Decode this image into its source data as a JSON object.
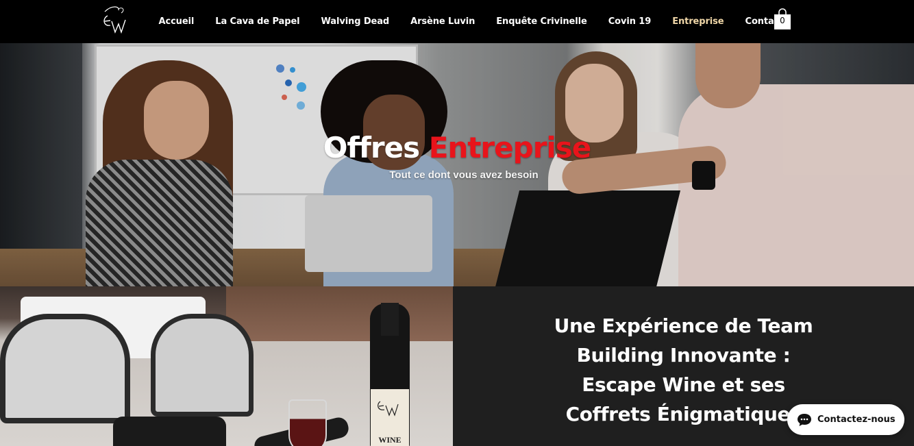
{
  "header": {
    "logo_text": "EW",
    "nav": [
      {
        "label": "Accueil",
        "active": false
      },
      {
        "label": "La Cava de Papel",
        "active": false
      },
      {
        "label": "Walving Dead",
        "active": false
      },
      {
        "label": "Arsène Luvin",
        "active": false
      },
      {
        "label": "Enquête Crivinelle",
        "active": false
      },
      {
        "label": "Covin 19",
        "active": false
      },
      {
        "label": "Entreprise",
        "active": true
      },
      {
        "label": "Contact",
        "active": false
      }
    ],
    "cart_count": "0",
    "active_color": "#f0d7a8"
  },
  "hero": {
    "title_white": "Offres",
    "title_red": "Entreprise",
    "subtitle": "Tout ce dont vous avez besoin",
    "title_red_color": "#e8141b"
  },
  "feature": {
    "title_lines": [
      "Une Expérience de Team",
      "Building Innovante :",
      "Escape Wine et ses",
      "Coffrets Énigmatiques"
    ],
    "bottle_label": "WINE"
  },
  "chat": {
    "label": "Contactez-nous"
  }
}
